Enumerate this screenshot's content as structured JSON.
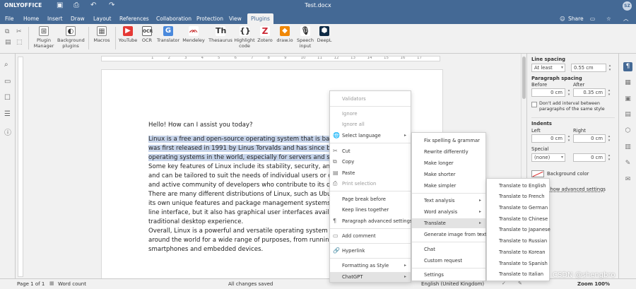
{
  "titlebar": {
    "logo": "ONLYOFFICE",
    "document": "Test.docx",
    "user_initials": "SZ"
  },
  "menu_tabs": [
    "File",
    "Home",
    "Insert",
    "Draw",
    "Layout",
    "References",
    "Collaboration",
    "Protection",
    "View",
    "Plugins"
  ],
  "share_label": "Share",
  "toolbar": {
    "plugin_manager": "Plugin Manager",
    "background_plugins": "Background plugins",
    "macros": "Macros",
    "youtube": "YouTube",
    "ocr": "OCR",
    "translator": "Translator",
    "mendeley": "Mendeley",
    "thesaurus": "Thesaurus",
    "highlight_code": "Highlight code",
    "zotero": "Zotero",
    "drawio": "draw.io",
    "speech_input": "Speech input",
    "deepl": "DeepL"
  },
  "ruler": {
    "h_ticks": [
      "1",
      "2",
      "3",
      "4",
      "5",
      "6",
      "7",
      "8",
      "9",
      "10",
      "11",
      "12",
      "13",
      "14",
      "15",
      "16",
      "17"
    ]
  },
  "document": {
    "greeting": "Hello! How can I assist you today?",
    "p1": [
      "Linux is a free and open-source operating system that is based o",
      "was first released in 1991 by Linus Torvalds and has since becor",
      "operating systems in the world, especially for servers and superc"
    ],
    "p2": [
      "Some key features of Linux include its stability, security, and flex",
      "and can be tailored to suit the needs of individual users or organi",
      "and active community of developers who contribute to its ongoin"
    ],
    "p3": [
      "There are many different distributions of Linux, such as Ubuntu, I",
      "its own unique features and package management systems. Linu",
      "line interface, but it also has graphical user interfaces available fo",
      "traditional desktop experience."
    ],
    "p4": [
      "Overall, Linux is a powerful and versatile operating system that is",
      "around the world for a wide range of purposes, from running web",
      "smartphones and embedded devices."
    ]
  },
  "right_panel": {
    "line_spacing": "Line spacing",
    "line_mode": "At least",
    "line_value": "0.55 cm",
    "paragraph_spacing": "Paragraph spacing",
    "before": "Before",
    "after": "After",
    "before_value": "0 cm",
    "after_value": "0.35 cm",
    "dont_add": "Don't add interval between paragraphs of the same style",
    "indents": "Indents",
    "left": "Left",
    "right": "Right",
    "left_value": "0 cm",
    "right_value": "0 cm",
    "special": "Special",
    "special_mode": "(none)",
    "special_value": "0 cm",
    "background_color": "Background color",
    "advanced": "Show advanced settings"
  },
  "context_menu": {
    "items": [
      "Validators",
      "Ignore",
      "Ignore all",
      "Select language",
      "Cut",
      "Copy",
      "Paste",
      "Print selection",
      "Page break before",
      "Keep lines together",
      "Paragraph advanced settings",
      "Add comment",
      "Hyperlink",
      "Formatting as Style",
      "ChatGPT"
    ]
  },
  "chatgpt_menu": {
    "items": [
      "Fix spelling & grammar",
      "Rewrite differently",
      "Make longer",
      "Make shorter",
      "Make simpler",
      "Text analysis",
      "Word analysis",
      "Translate",
      "Generate image from text",
      "Chat",
      "Custom request",
      "Settings"
    ]
  },
  "translate_menu": {
    "items": [
      "Translate to English",
      "Translate to French",
      "Translate to German",
      "Translate to Chinese",
      "Translate to Japanese",
      "Translate to Russian",
      "Translate to Korean",
      "Translate to Spanish",
      "Translate to Italian"
    ]
  },
  "statusbar": {
    "page": "Page 1 of 1",
    "word_count": "Word count",
    "saved": "All changes saved",
    "language": "English (United Kingdom)",
    "zoom": "Zoom 100%"
  },
  "watermark": "CSDN @shengbro",
  "colors": {
    "header": "#446995",
    "highlight": "#c7d4ea",
    "menu_selected": "#e3e3e3"
  }
}
